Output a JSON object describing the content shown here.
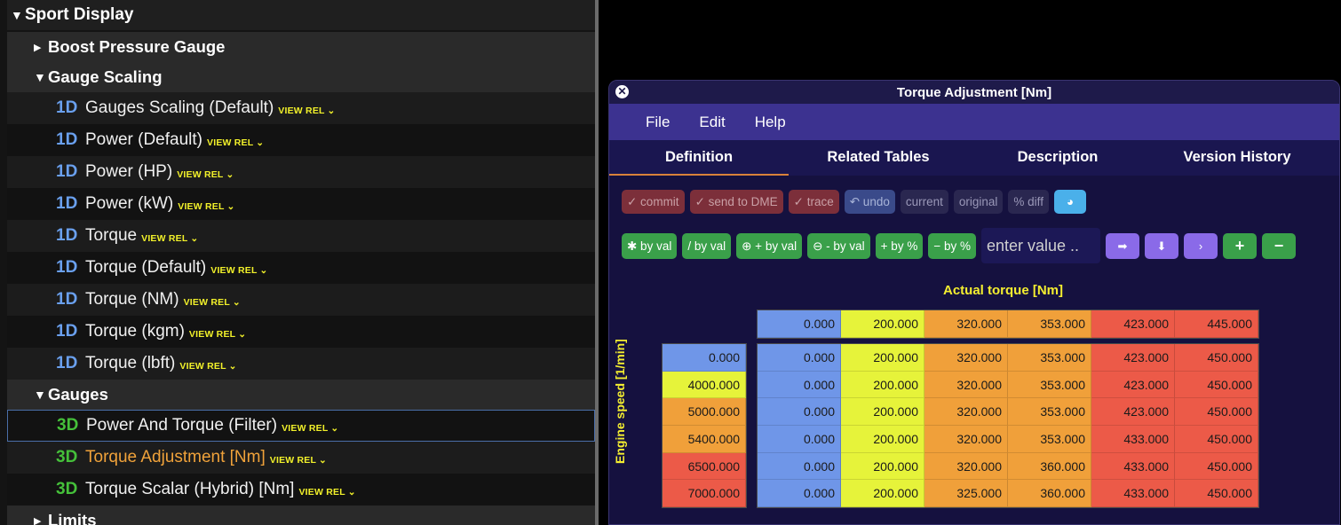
{
  "tree": {
    "items": [
      {
        "kind": "section",
        "expanded": true,
        "label": "Sport Display"
      },
      {
        "kind": "group",
        "expanded": false,
        "label": "Boost Pressure Gauge"
      },
      {
        "kind": "group",
        "expanded": true,
        "label": "Gauge Scaling"
      },
      {
        "kind": "leaf",
        "dim": "1D",
        "label": "Gauges Scaling (Default)",
        "rel": "VIEW REL ⌄"
      },
      {
        "kind": "leaf",
        "dim": "1D",
        "label": "Power (Default)",
        "rel": "VIEW REL ⌄"
      },
      {
        "kind": "leaf",
        "dim": "1D",
        "label": "Power (HP)",
        "rel": "VIEW REL ⌄"
      },
      {
        "kind": "leaf",
        "dim": "1D",
        "label": "Power (kW)",
        "rel": "VIEW REL ⌄"
      },
      {
        "kind": "leaf",
        "dim": "1D",
        "label": "Torque",
        "rel": "VIEW REL ⌄"
      },
      {
        "kind": "leaf",
        "dim": "1D",
        "label": "Torque (Default)",
        "rel": "VIEW REL ⌄"
      },
      {
        "kind": "leaf",
        "dim": "1D",
        "label": "Torque (NM)",
        "rel": "VIEW REL ⌄"
      },
      {
        "kind": "leaf",
        "dim": "1D",
        "label": "Torque (kgm)",
        "rel": "VIEW REL ⌄"
      },
      {
        "kind": "leaf",
        "dim": "1D",
        "label": "Torque (lbft)",
        "rel": "VIEW REL ⌄"
      },
      {
        "kind": "group",
        "expanded": true,
        "label": "Gauges"
      },
      {
        "kind": "leaf",
        "dim": "3D",
        "label": "Power And Torque (Filter)",
        "rel": "VIEW REL ⌄",
        "selected": true
      },
      {
        "kind": "leaf",
        "dim": "3D",
        "label": "Torque Adjustment [Nm]",
        "rel": "VIEW REL ⌄",
        "highlight": true
      },
      {
        "kind": "leaf",
        "dim": "3D",
        "label": "Torque Scalar (Hybrid) [Nm]",
        "rel": "VIEW REL ⌄"
      },
      {
        "kind": "group",
        "expanded": false,
        "label": "Limits"
      }
    ]
  },
  "window": {
    "title": "Torque Adjustment [Nm]",
    "menu": [
      "File",
      "Edit",
      "Help"
    ],
    "tabs": [
      "Definition",
      "Related Tables",
      "Description",
      "Version History"
    ],
    "active_tab": "Definition",
    "toolbar1": [
      {
        "label": "✓ commit",
        "style": "red"
      },
      {
        "label": "✓ send to DME",
        "style": "red"
      },
      {
        "label": "✓ trace",
        "style": "red"
      },
      {
        "label": "↶ undo",
        "style": "blue"
      },
      {
        "label": "current",
        "style": "grey"
      },
      {
        "label": "original",
        "style": "grey"
      },
      {
        "label": "% diff",
        "style": "grey"
      },
      {
        "label": "◕",
        "style": "lightblue"
      }
    ],
    "toolbar2": [
      {
        "label": "✱ by val"
      },
      {
        "label": "/ by val"
      },
      {
        "label": "⊕ + by val"
      },
      {
        "label": "⊖ - by val"
      },
      {
        "label": "+ by %"
      },
      {
        "label": "− by %"
      }
    ],
    "value_placeholder": "enter value ..",
    "nav_buttons": [
      "➡",
      "⬇",
      "›"
    ],
    "step_buttons": [
      "+",
      "−"
    ]
  },
  "chart_data": {
    "type": "table",
    "title": "Actual torque [Nm]",
    "ylabel": "Engine speed [1/min]",
    "x_axis": [
      "0.000",
      "200.000",
      "320.000",
      "353.000",
      "423.000",
      "445.000"
    ],
    "y_axis": [
      "0.000",
      "4000.000",
      "5000.000",
      "5400.000",
      "6500.000",
      "7000.000"
    ],
    "rows": [
      [
        "0.000",
        "200.000",
        "320.000",
        "353.000",
        "423.000",
        "450.000"
      ],
      [
        "0.000",
        "200.000",
        "320.000",
        "353.000",
        "423.000",
        "450.000"
      ],
      [
        "0.000",
        "200.000",
        "320.000",
        "353.000",
        "423.000",
        "450.000"
      ],
      [
        "0.000",
        "200.000",
        "320.000",
        "353.000",
        "433.000",
        "450.000"
      ],
      [
        "0.000",
        "200.000",
        "320.000",
        "360.000",
        "433.000",
        "450.000"
      ],
      [
        "0.000",
        "200.000",
        "325.000",
        "360.000",
        "433.000",
        "450.000"
      ]
    ],
    "color_scale": [
      "#6f96e8",
      "#5ee040",
      "#e6f33a",
      "#f0a03a",
      "#ec5a48"
    ]
  }
}
